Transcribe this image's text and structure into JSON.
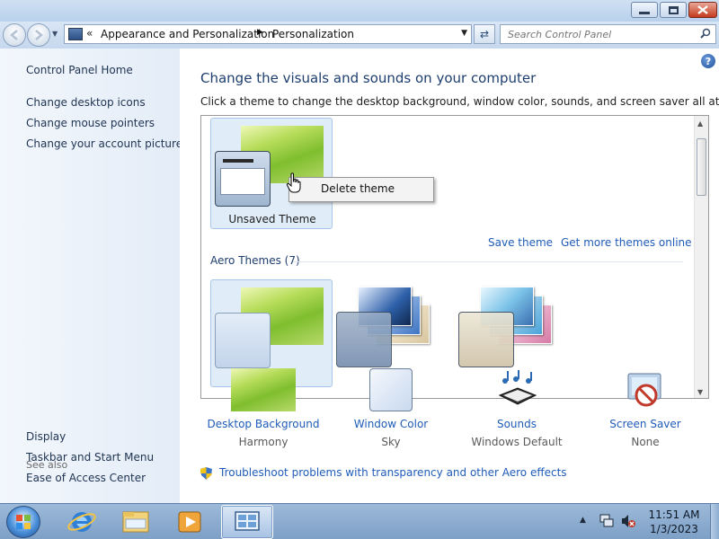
{
  "window": {
    "controls": [
      "minimize",
      "maximize",
      "close"
    ]
  },
  "address": {
    "crumbs": [
      "Appearance and Personalization",
      "Personalization"
    ]
  },
  "search": {
    "placeholder": "Search Control Panel"
  },
  "sidebar": {
    "home": "Control Panel Home",
    "links": [
      "Change desktop icons",
      "Change mouse pointers",
      "Change your account picture"
    ],
    "see_also_heading": "See also",
    "see_also": [
      "Display",
      "Taskbar and Start Menu",
      "Ease of Access Center"
    ]
  },
  "main": {
    "title": "Change the visuals and sounds on your computer",
    "subtitle": "Click a theme to change the desktop background, window color, sounds, and screen saver all at once.",
    "unsaved_theme": "Unsaved Theme",
    "context_menu": {
      "delete": "Delete theme"
    },
    "save_theme": "Save theme",
    "get_more": "Get more themes online",
    "aero_heading": "Aero Themes (7)"
  },
  "settings": [
    {
      "label": "Desktop Background",
      "value": "Harmony",
      "icon": "desktop-background-icon"
    },
    {
      "label": "Window Color",
      "value": "Sky",
      "icon": "window-color-icon"
    },
    {
      "label": "Sounds",
      "value": "Windows Default",
      "icon": "sounds-icon"
    },
    {
      "label": "Screen Saver",
      "value": "None",
      "icon": "screen-saver-icon"
    }
  ],
  "troubleshoot": "Troubleshoot problems with transparency and other Aero effects",
  "taskbar": {
    "time": "11:51 AM",
    "date": "1/3/2023"
  },
  "colors": {
    "link": "#1f5cb8",
    "title": "#1e3e6e",
    "sidebar": "#e3ecf7",
    "selected_tile": "#e0ecf8"
  }
}
